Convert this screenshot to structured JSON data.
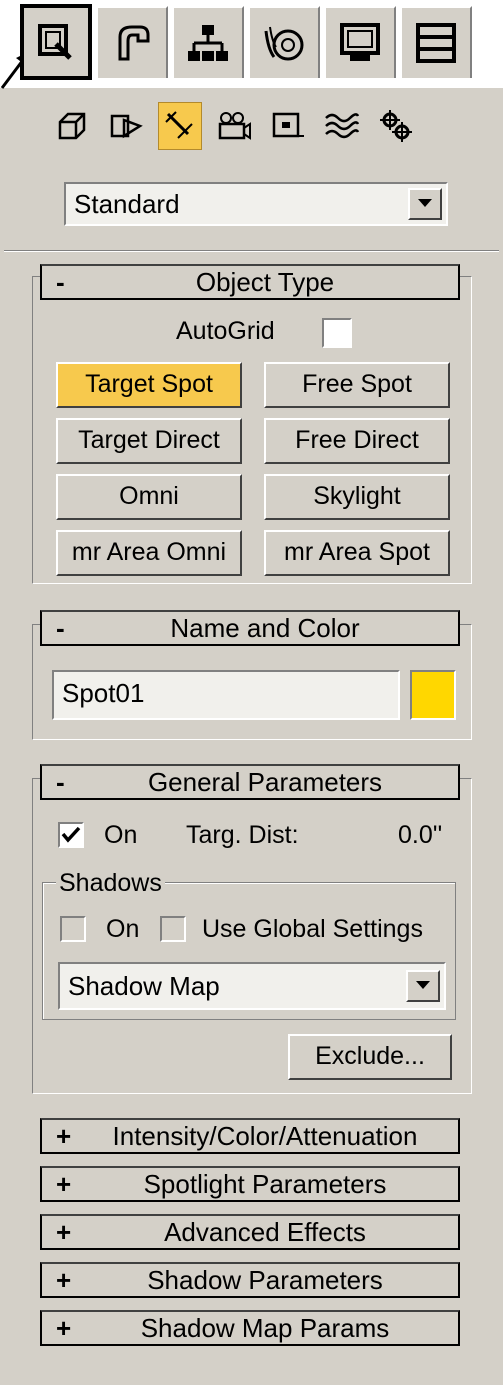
{
  "command_panel": {
    "tabs": [
      {
        "name": "create-tab-icon",
        "active": true
      },
      {
        "name": "modify-tab-icon",
        "active": false
      },
      {
        "name": "hierarchy-tab-icon",
        "active": false
      },
      {
        "name": "motion-tab-icon",
        "active": false
      },
      {
        "name": "display-tab-icon",
        "active": false
      },
      {
        "name": "utilities-tab-icon",
        "active": false
      }
    ],
    "categories": [
      {
        "name": "geometry-icon",
        "active": false
      },
      {
        "name": "shapes-icon",
        "active": false
      },
      {
        "name": "lights-icon",
        "active": true
      },
      {
        "name": "cameras-icon",
        "active": false
      },
      {
        "name": "helpers-icon",
        "active": false
      },
      {
        "name": "space-warps-icon",
        "active": false
      },
      {
        "name": "systems-icon",
        "active": false
      }
    ],
    "type_dropdown": {
      "value": "Standard"
    }
  },
  "object_type": {
    "sign": "-",
    "title": "Object Type",
    "autogrid_label": "AutoGrid",
    "autogrid_checked": false,
    "buttons": [
      {
        "label": "Target Spot",
        "active": true
      },
      {
        "label": "Free Spot",
        "active": false
      },
      {
        "label": "Target Direct",
        "active": false
      },
      {
        "label": "Free Direct",
        "active": false
      },
      {
        "label": "Omni",
        "active": false
      },
      {
        "label": "Skylight",
        "active": false
      },
      {
        "label": "mr Area Omni",
        "active": false
      },
      {
        "label": "mr Area Spot",
        "active": false
      }
    ]
  },
  "name_and_color": {
    "sign": "-",
    "title": "Name and Color",
    "name_value": "Spot01",
    "color": "#ffd700"
  },
  "general_parameters": {
    "sign": "-",
    "title": "General Parameters",
    "on_label": "On",
    "on_checked": true,
    "targ_dist_label": "Targ. Dist:",
    "targ_dist_value": "0.0''",
    "shadows_label": "Shadows",
    "shadows_on_label": "On",
    "use_global_label": "Use Global Settings",
    "shadow_type": "Shadow Map",
    "exclude_label": "Exclude..."
  },
  "collapsed_rollouts": [
    {
      "sign": "+",
      "title": "Intensity/Color/Attenuation"
    },
    {
      "sign": "+",
      "title": "Spotlight Parameters"
    },
    {
      "sign": "+",
      "title": "Advanced Effects"
    },
    {
      "sign": "+",
      "title": "Shadow Parameters"
    },
    {
      "sign": "+",
      "title": "Shadow Map Params"
    }
  ],
  "colors": {
    "panel": "#d4d0c8",
    "active_highlight": "#f7c94d"
  }
}
